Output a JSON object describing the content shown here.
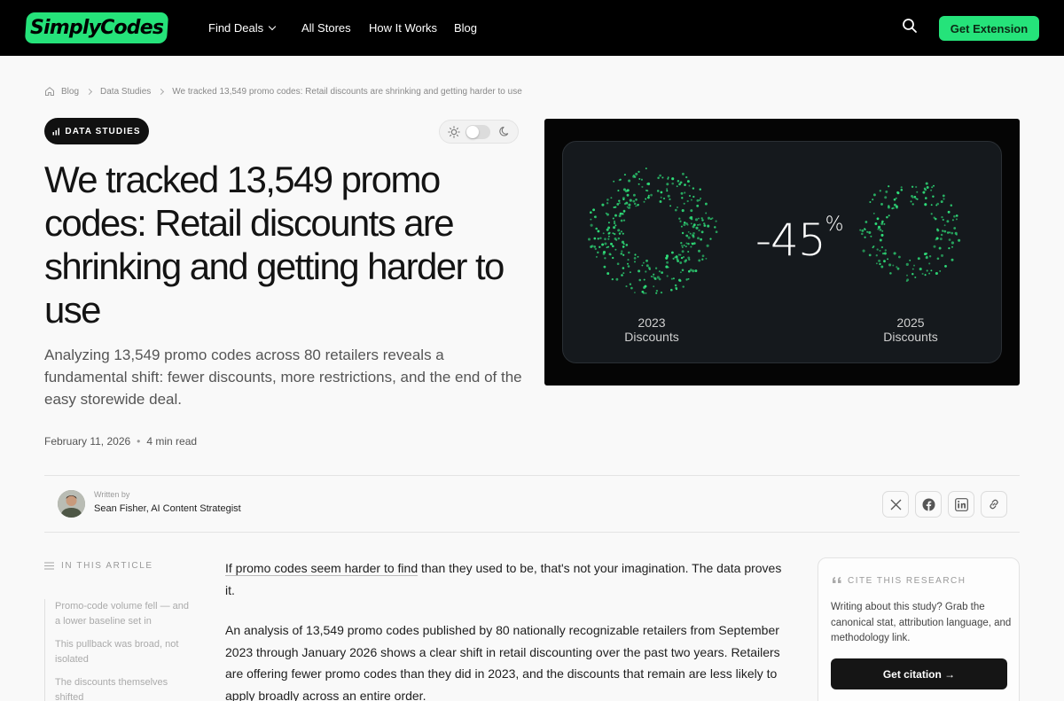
{
  "brand": {
    "name": "SimplyCodes",
    "accent": "#25e37a"
  },
  "nav": {
    "find_deals": "Find Deals",
    "all_stores": "All Stores",
    "how_it_works": "How It Works",
    "blog": "Blog",
    "cta": "Get Extension",
    "search_icon": "search-icon"
  },
  "breadcrumb": {
    "home": "Blog",
    "category": "Data Studies",
    "current": "We tracked 13,549 promo codes: Retail discounts are shrinking and getting harder to use"
  },
  "article": {
    "tag": "DATA STUDIES",
    "title": "We tracked 13,549 promo codes: Retail discounts are shrinking and getting harder to use",
    "subtitle": "Analyzing 13,549 promo codes across 80 retailers reveals a fundamental shift: fewer discounts, more restrictions, and the end of the easy storewide deal.",
    "date": "February 11, 2026",
    "read_time": "4 min read",
    "dot": "•"
  },
  "hero": {
    "change_value": "-45",
    "change_unit": "%",
    "left_caption_1": "2023",
    "left_caption_2": "Discounts",
    "right_caption_1": "2025",
    "right_caption_2": "Discounts",
    "dot_color": "#2fe07a"
  },
  "author": {
    "written_by": "Written by",
    "name": "Sean Fisher, AI Content Strategist"
  },
  "share": [
    "x-icon",
    "facebook-icon",
    "linkedin-icon",
    "link-icon"
  ],
  "toc": {
    "title": "IN THIS ARTICLE",
    "items": [
      "Promo-code volume fell — and a lower baseline set in",
      "This pullback was broad, not isolated",
      "The discounts themselves shifted"
    ]
  },
  "body": {
    "p1_link": "If promo codes seem harder to find",
    "p1_rest": " than they used to be, that's not your imagination. The data proves it.",
    "p2": "An analysis of 13,549 promo codes published by 80 nationally recognizable retailers from September 2023 through January 2026 shows a clear shift in retail discounting over the past two years. Retailers are offering fewer promo codes than they did in 2023, and the discounts that remain are less likely to apply broadly across an entire order."
  },
  "cite": {
    "title": "CITE THIS RESEARCH",
    "body": "Writing about this study? Grab the canonical stat, attribution language, and methodology link.",
    "button": "Get citation →"
  }
}
